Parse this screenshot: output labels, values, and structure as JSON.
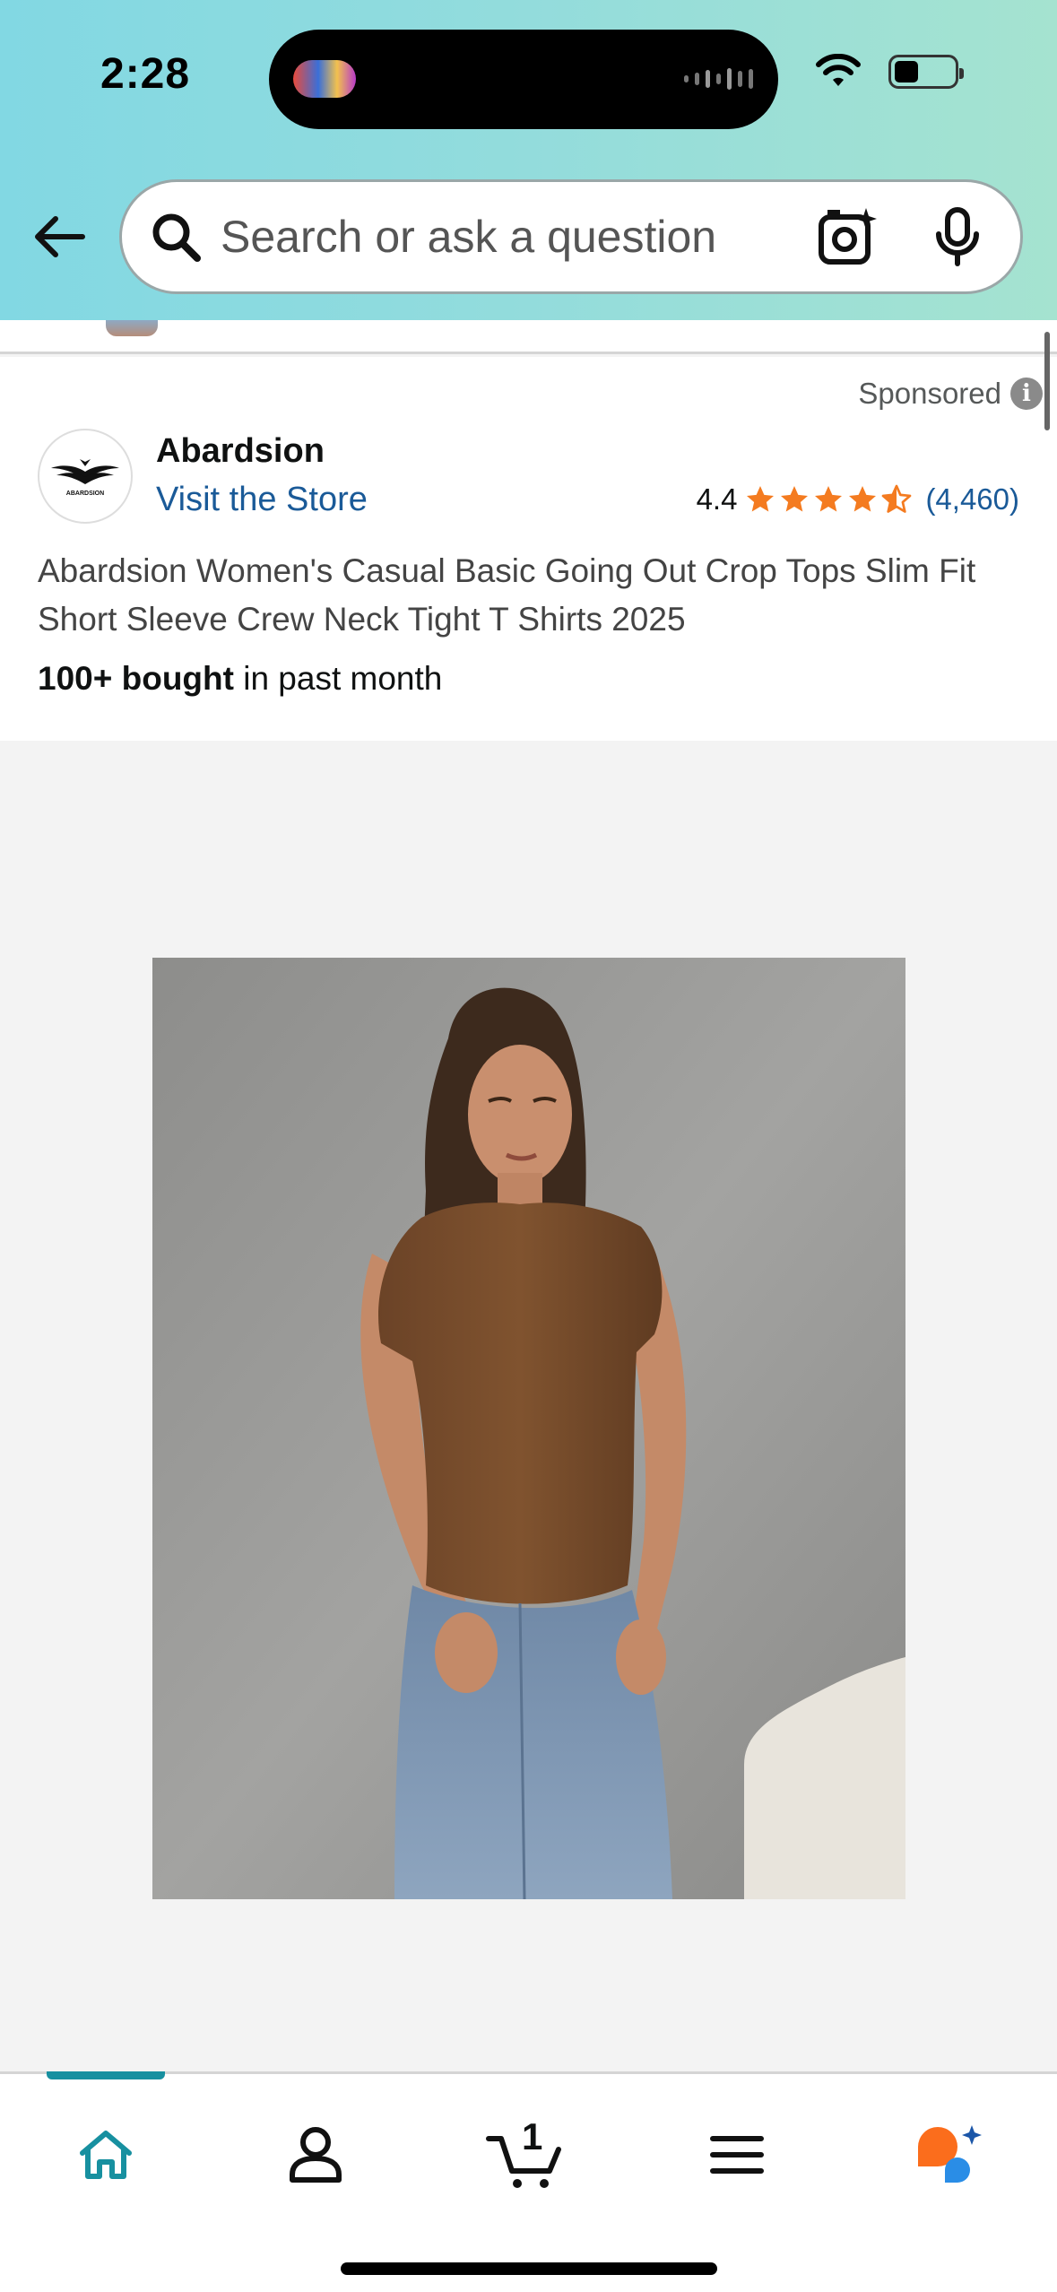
{
  "status_bar": {
    "time": "2:28"
  },
  "search": {
    "placeholder": "Search or ask a question"
  },
  "ad": {
    "sponsored_label": "Sponsored",
    "brand_name": "Abardsion",
    "logo_text": "ABARDSION",
    "visit_store": "Visit the Store",
    "rating_value": "4.4",
    "star_rating": 4.4,
    "review_count": "(4,460)",
    "product_title": "Abardsion Women's Casual Basic Going Out Crop Tops Slim Fit Short Sleeve Crew Neck Tight T Shirts 2025",
    "bought_count": "100+ bought",
    "bought_suffix": " in past month"
  },
  "bottom_nav": {
    "items": [
      "home-icon",
      "account-icon",
      "cart-icon",
      "menu-icon",
      "rufus-icon"
    ],
    "cart_count": "1",
    "active": "home"
  },
  "colors": {
    "header_gradient_start": "#82d8e3",
    "header_gradient_end": "#a5e3d0",
    "link": "#1a5a98",
    "star": "#f47b20",
    "nav_active": "#1790a0"
  }
}
